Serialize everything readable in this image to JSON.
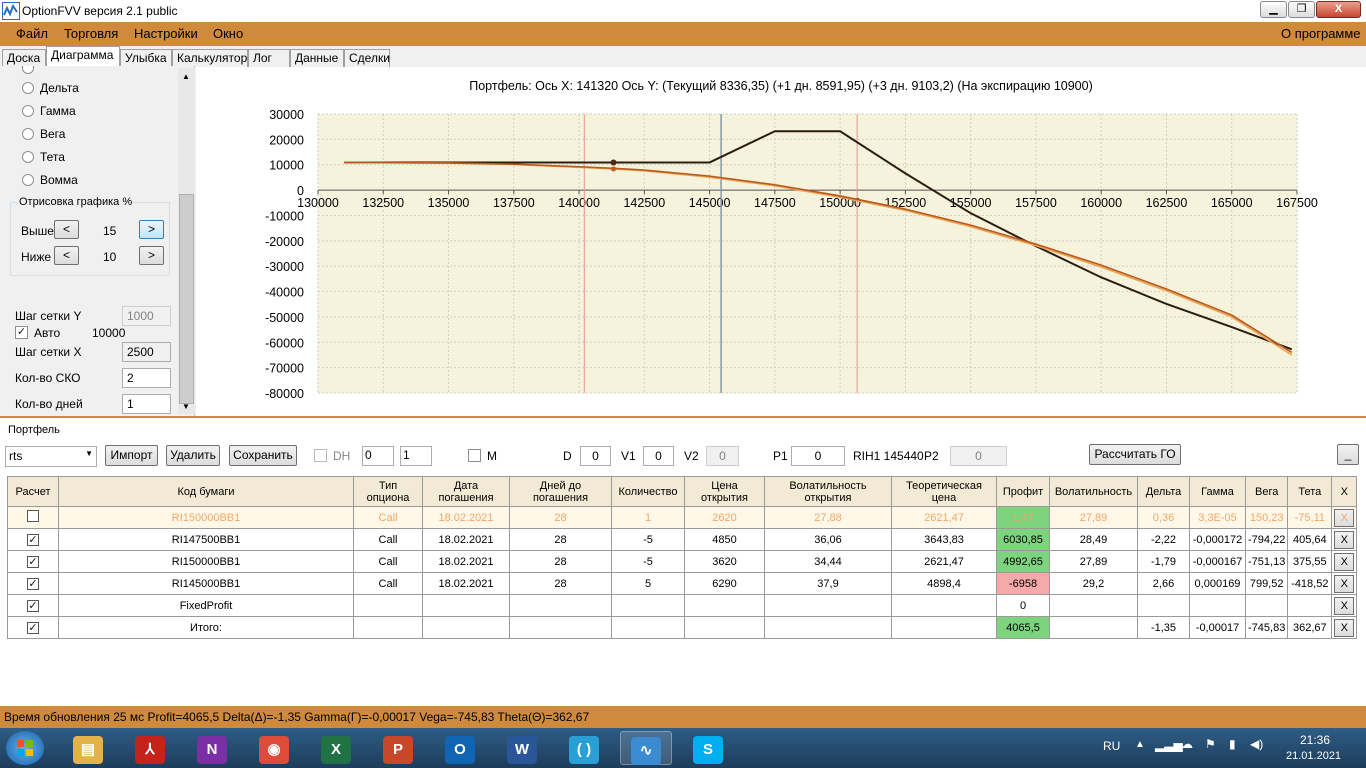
{
  "window": {
    "title": "OptionFVV версия 2.1 public",
    "min_label": "▁",
    "max_label": "❐",
    "close_label": "X"
  },
  "menu": {
    "items": [
      "Файл",
      "Торговля",
      "Настройки",
      "Окно"
    ],
    "about": "О программе"
  },
  "tabs": [
    "Доска",
    "Диаграмма",
    "Улыбка",
    "Калькулятор",
    "Лог",
    "Данные",
    "Сделки"
  ],
  "active_tab": "Диаграмма",
  "left": {
    "radios": [
      "Дельта",
      "Гамма",
      "Вега",
      "Тета",
      "Вомма"
    ],
    "draw_group": "Отрисовка графика %",
    "above_label": "Выше",
    "above_value": "15",
    "below_label": "Ниже",
    "below_value": "10",
    "dec": "<",
    "inc": ">",
    "grid_y_label": "Шаг сетки Y",
    "grid_y_value": "1000",
    "auto_label": "Авто",
    "auto_value": "10000",
    "grid_x_label": "Шаг сетки X",
    "grid_x_value": "2500",
    "sko_label": "Кол-во СКО",
    "sko_value": "2",
    "days_label": "Кол-во дней",
    "days_value": "1"
  },
  "chart_title": "Портфель: Ось X:  141320 Ось Y:  (Текущий 8336,35)  (+1 дн. 8591,95)  (+3 дн. 9103,2)  (На экспирацию 10900)",
  "chart_data": {
    "type": "line",
    "xlim": [
      130000,
      167500
    ],
    "ylim": [
      -80000,
      30000
    ],
    "x_ticks": [
      130000,
      132500,
      135000,
      137500,
      140000,
      142500,
      145000,
      147500,
      150000,
      152500,
      155000,
      157500,
      160000,
      162500,
      165000,
      167500
    ],
    "y_ticks": [
      30000,
      20000,
      10000,
      0,
      -10000,
      -20000,
      -30000,
      -40000,
      -50000,
      -60000,
      -70000,
      -80000
    ],
    "grid": true,
    "cursor_x": 141320,
    "vertical_markers": {
      "blue": 145440,
      "red": [
        140200,
        150650
      ]
    },
    "series": [
      {
        "name": "На экспирацию",
        "color": "#2b1d12",
        "x": [
          131000,
          137500,
          140000,
          142500,
          145000,
          147500,
          150000,
          152500,
          155000,
          157500,
          160000,
          162500,
          165000,
          167300
        ],
        "y": [
          10900,
          10900,
          10900,
          10900,
          10900,
          23200,
          23200,
          6600,
          -9100,
          -22100,
          -34400,
          -44900,
          -54000,
          -62800
        ]
      },
      {
        "name": "Текущий",
        "color": "#f0a050",
        "x": [
          131000,
          135000,
          137500,
          140000,
          141320,
          142500,
          145000,
          147500,
          150000,
          152500,
          155000,
          157500,
          160000,
          162500,
          165000,
          167300
        ],
        "y": [
          10900,
          10600,
          10100,
          9000,
          8336,
          7600,
          5100,
          1700,
          -2800,
          -8000,
          -14400,
          -21900,
          -30300,
          -39700,
          -50000,
          -65000
        ]
      },
      {
        "name": "+1 дн.",
        "color": "#b85a20",
        "x": [
          131000,
          135000,
          137500,
          140000,
          141320,
          142500,
          145000,
          147500,
          150000,
          152500,
          155000,
          157500,
          160000,
          162500,
          165000,
          167300
        ],
        "y": [
          10900,
          10700,
          10200,
          9200,
          8592,
          7900,
          5500,
          2100,
          -2300,
          -7500,
          -13800,
          -21300,
          -29600,
          -39000,
          -49300,
          -64000
        ]
      }
    ]
  },
  "portfolio": {
    "section": "Портфель",
    "account": "rts",
    "import": "Импорт",
    "delete": "Удалить",
    "save": "Сохранить",
    "dh": "DH",
    "spin1": "0",
    "spin2": "1",
    "m": "M",
    "d_label": "D",
    "d_value": "0",
    "v1_label": "V1",
    "v1_value": "0",
    "v2_label": "V2",
    "v2_value": "0",
    "p1_label": "P1",
    "p1_value": "0",
    "rih": "RIH1 145440",
    "p2_label": "P2",
    "p2_value": "0",
    "calc_go": "Рассчитать ГО",
    "collapse": "_",
    "columns": [
      "Расчет",
      "Код бумаги",
      "Тип опциона",
      "Дата погашения",
      "Дней до погашения",
      "Количество",
      "Цена открытия",
      "Волатильность открытия",
      "Теоретическая цена",
      "Профит",
      "Волатильность",
      "Дельта",
      "Гамма",
      "Вега",
      "Тета",
      "X"
    ],
    "rows": [
      {
        "calc": "",
        "code": "RI150000BB1",
        "type": "Call",
        "date": "18.02.2021",
        "days": "28",
        "qty": "1",
        "open": "2620",
        "vol_open": "27,88",
        "theo": "2621,47",
        "profit": "1,47",
        "vol": "27,89",
        "delta": "0,36",
        "gamma": "3,3E-05",
        "vega": "150,23",
        "theta": "-75,11",
        "x": "X"
      },
      {
        "calc": "✓",
        "code": "RI147500BB1",
        "type": "Call",
        "date": "18.02.2021",
        "days": "28",
        "qty": "-5",
        "open": "4850",
        "vol_open": "36,06",
        "theo": "3643,83",
        "profit": "6030,85",
        "vol": "28,49",
        "delta": "-2,22",
        "gamma": "-0,000172",
        "vega": "-794,22",
        "theta": "405,64",
        "x": "X"
      },
      {
        "calc": "✓",
        "code": "RI150000BB1",
        "type": "Call",
        "date": "18.02.2021",
        "days": "28",
        "qty": "-5",
        "open": "3620",
        "vol_open": "34,44",
        "theo": "2621,47",
        "profit": "4992,65",
        "vol": "27,89",
        "delta": "-1,79",
        "gamma": "-0,000167",
        "vega": "-751,13",
        "theta": "375,55",
        "x": "X"
      },
      {
        "calc": "✓",
        "code": "RI145000BB1",
        "type": "Call",
        "date": "18.02.2021",
        "days": "28",
        "qty": "5",
        "open": "6290",
        "vol_open": "37,9",
        "theo": "4898,4",
        "profit": "-6958",
        "vol": "29,2",
        "delta": "2,66",
        "gamma": "0,000169",
        "vega": "799,52",
        "theta": "-418,52",
        "x": "X"
      },
      {
        "calc": "✓",
        "code": "FixedProfit",
        "type": "",
        "date": "",
        "days": "",
        "qty": "",
        "open": "",
        "vol_open": "",
        "theo": "",
        "profit": "0",
        "vol": "",
        "delta": "",
        "gamma": "",
        "vega": "",
        "theta": "",
        "x": "X"
      },
      {
        "calc": "✓",
        "code": "Итого:",
        "type": "",
        "date": "",
        "days": "",
        "qty": "",
        "open": "",
        "vol_open": "",
        "theo": "",
        "profit": "4065,5",
        "vol": "",
        "delta": "-1,35",
        "gamma": "-0,00017",
        "vega": "-745,83",
        "theta": "362,67",
        "x": "X"
      }
    ]
  },
  "status": "Время обновления 25 мс  Profit=4065,5 Delta(Δ)=-1,35 Gamma(Γ)=-0,00017 Vega=-745,83 Theta(Θ)=362,67",
  "taskbar": {
    "apps": [
      {
        "name": "explorer",
        "glyph": "▤",
        "color": "#e3b34a"
      },
      {
        "name": "acrobat",
        "glyph": "⅄",
        "color": "#c4221b"
      },
      {
        "name": "onenote",
        "glyph": "N",
        "color": "#7a2fa5"
      },
      {
        "name": "chrome",
        "glyph": "◉",
        "color": "#dd4b39"
      },
      {
        "name": "excel",
        "glyph": "X",
        "color": "#1f7244"
      },
      {
        "name": "powerpoint",
        "glyph": "P",
        "color": "#c8472a"
      },
      {
        "name": "outlook",
        "glyph": "O",
        "color": "#0f64b4"
      },
      {
        "name": "word",
        "glyph": "W",
        "color": "#2a5699"
      },
      {
        "name": "brackets",
        "glyph": "( )",
        "color": "#2a9fd6"
      },
      {
        "name": "optionfvv",
        "glyph": "∿",
        "color": "#3a8bd0"
      },
      {
        "name": "skype",
        "glyph": "S",
        "color": "#00aff0"
      }
    ],
    "lang": "RU",
    "time": "21:36",
    "date": "21.01.2021"
  }
}
